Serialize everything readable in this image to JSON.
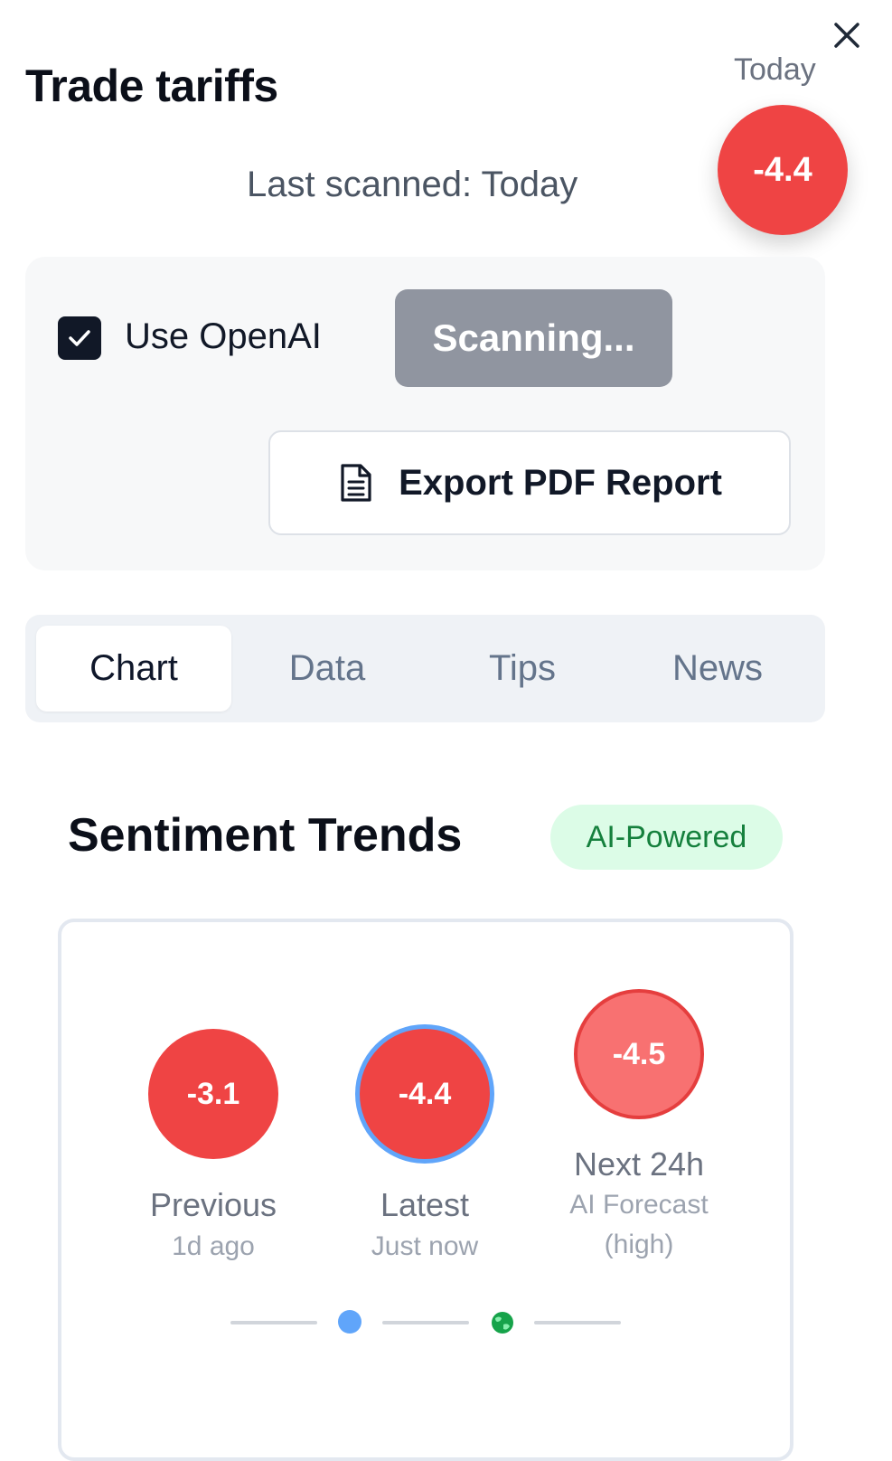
{
  "header": {
    "title": "Trade tariffs",
    "period_label": "Today",
    "score": "-4.4",
    "last_scanned": "Last scanned: Today"
  },
  "controls": {
    "use_openai_label": "Use OpenAI",
    "use_openai_checked": true,
    "scan_button_label": "Scanning...",
    "export_button_label": "Export PDF Report"
  },
  "tabs": [
    {
      "label": "Chart",
      "active": true
    },
    {
      "label": "Data",
      "active": false
    },
    {
      "label": "Tips",
      "active": false
    },
    {
      "label": "News",
      "active": false
    }
  ],
  "sentiment": {
    "title": "Sentiment Trends",
    "badge": "AI-Powered",
    "points": [
      {
        "value": "-3.1",
        "label": "Previous",
        "sublabel": "1d ago"
      },
      {
        "value": "-4.4",
        "label": "Latest",
        "sublabel": "Just now"
      },
      {
        "value": "-4.5",
        "label": "Next 24h",
        "sublabel": "AI Forecast",
        "sublabel2": "(high)"
      }
    ]
  },
  "colors": {
    "negative": "#ef4444",
    "forecast": "#f87171",
    "accent_blue": "#60a5fa",
    "ai_badge_bg": "#dcfce7",
    "ai_badge_text": "#15803d",
    "scan_button_bg": "#9095a0"
  },
  "icons": {
    "close": "close-icon",
    "checkbox": "checkmark-icon",
    "export": "document-icon",
    "timeline_latest": "dot-icon",
    "timeline_forecast": "globe-icon"
  }
}
